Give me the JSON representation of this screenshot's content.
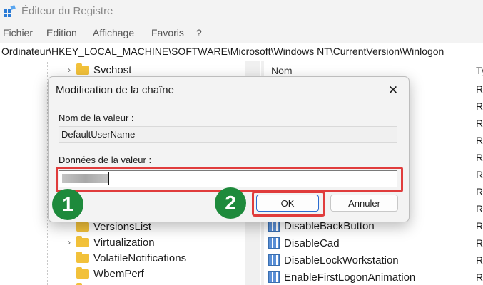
{
  "window": {
    "title": "Éditeur du Registre"
  },
  "menu": [
    "Fichier",
    "Edition",
    "Affichage",
    "Favoris",
    "?"
  ],
  "address": "Ordinateur\\HKEY_LOCAL_MACHINE\\SOFTWARE\\Microsoft\\Windows NT\\CurrentVersion\\Winlogon",
  "tree": {
    "items": [
      {
        "label": "Svchost",
        "expandable": true
      },
      {
        "label": "VersionsList",
        "expandable": false
      },
      {
        "label": "Virtualization",
        "expandable": true
      },
      {
        "label": "VolatileNotifications",
        "expandable": false
      },
      {
        "label": "WbemPerf",
        "expandable": false
      }
    ]
  },
  "list": {
    "col_name": "Nom",
    "col_type": "Ty",
    "rows": [
      {
        "name": "DisableBackButton",
        "type": "R"
      },
      {
        "name": "DisableCad",
        "type": "R"
      },
      {
        "name": "DisableLockWorkstation",
        "type": "R"
      },
      {
        "name": "EnableFirstLogonAnimation",
        "type": "R"
      }
    ],
    "type_column_hidden": [
      "R",
      "R",
      "R",
      "R",
      "R",
      "R",
      "R",
      "R"
    ]
  },
  "dialog": {
    "title": "Modification de la chaîne",
    "close": "✕",
    "name_label": "Nom de la valeur :",
    "name_value": "DefaultUserName",
    "data_label": "Données de la valeur :",
    "data_value": "",
    "ok_label": "OK",
    "cancel_label": "Annuler"
  },
  "annotations": {
    "step1": "1",
    "step2": "2"
  },
  "colors": {
    "highlight": "#e03c3c",
    "badge": "#1e8a3c",
    "accent": "#2b6cd0"
  }
}
